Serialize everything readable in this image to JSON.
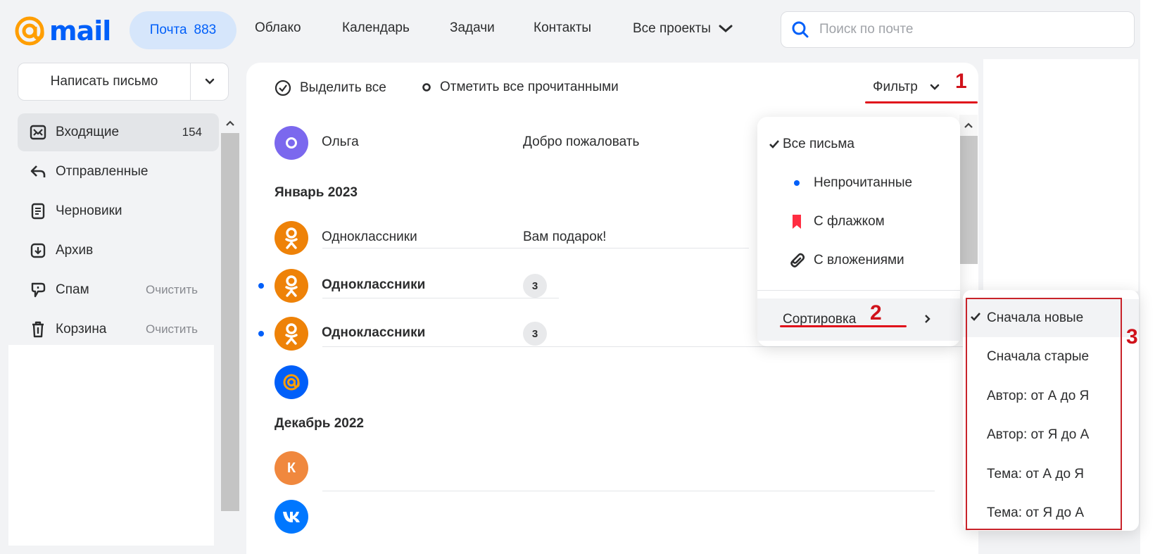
{
  "logo": {
    "text": "mail",
    "brand_color": "#005ff9",
    "at_color": "#ff9e00"
  },
  "nav": {
    "mail_label": "Почта",
    "mail_count": "883",
    "cloud": "Облако",
    "calendar": "Календарь",
    "tasks": "Задачи",
    "contacts": "Контакты",
    "all_projects": "Все проекты"
  },
  "search": {
    "placeholder": "Поиск по почте"
  },
  "compose": {
    "label": "Написать письмо"
  },
  "folders": [
    {
      "label": "Входящие",
      "count": "154",
      "icon": "inbox-icon"
    },
    {
      "label": "Отправленные",
      "icon": "sent-icon"
    },
    {
      "label": "Черновики",
      "icon": "drafts-icon"
    },
    {
      "label": "Архив",
      "icon": "archive-icon"
    },
    {
      "label": "Спам",
      "action": "Очистить",
      "icon": "spam-icon"
    },
    {
      "label": "Корзина",
      "action": "Очистить",
      "icon": "trash-icon"
    }
  ],
  "toolbar": {
    "select_all": "Выделить все",
    "mark_all_read": "Отметить все прочитанными",
    "filter": "Фильтр"
  },
  "annotations": {
    "n1": "1",
    "n2": "2",
    "n3": "3"
  },
  "mail": {
    "row0": {
      "sender": "Ольга",
      "subject": "Добро пожаловать",
      "avatar_letter": "О"
    },
    "month1": "Январь 2023",
    "row1": {
      "sender": "Одноклассники",
      "subject": "Вам подарок!"
    },
    "row2": {
      "sender": "Одноклассники",
      "count": "3"
    },
    "row3": {
      "sender": "Одноклассники",
      "count": "3"
    },
    "month2": "Декабрь 2022",
    "row5": {
      "avatar_letter": "К"
    }
  },
  "filter_menu": {
    "all": "Все письма",
    "unread": "Непрочитанные",
    "flagged": "С флажком",
    "attachments": "С вложениями",
    "sort": "Сортировка"
  },
  "sort_menu": {
    "newest": "Сначала новые",
    "oldest": "Сначала старые",
    "author_az": "Автор: от А до Я",
    "author_za": "Автор: от Я до А",
    "subject_az": "Тема: от А до Я",
    "subject_za": "Тема: от Я до А"
  }
}
